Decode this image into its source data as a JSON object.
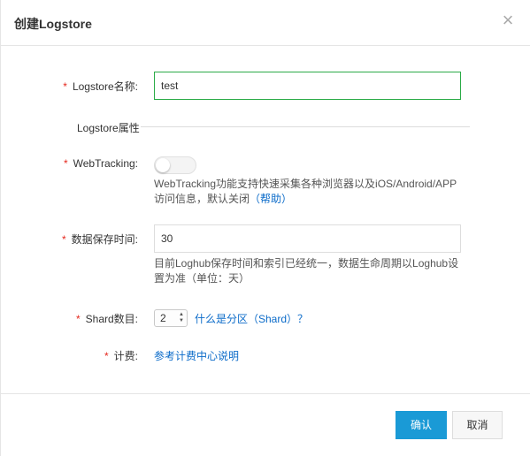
{
  "dialog": {
    "title": "创建Logstore",
    "close_symbol": "×"
  },
  "form": {
    "required_mark": "*",
    "name": {
      "label": "Logstore名称:",
      "value": "test"
    },
    "section_title": "Logstore属性",
    "webtracking": {
      "label": "WebTracking:",
      "enabled": false,
      "help_line1": "WebTracking功能支持快速采集各种浏览器以及iOS/Android/APP",
      "help_line2": "访问信息，默认关闭",
      "help_link": "（帮助）"
    },
    "retention": {
      "label": "数据保存时间:",
      "value": "30",
      "help_line1": "目前Loghub保存时间和索引已经统一，数据生命周期以Loghub设",
      "help_line2": "置为准（单位：天）"
    },
    "shard": {
      "label": "Shard数目:",
      "value": "2",
      "link": "什么是分区（Shard）？"
    },
    "billing": {
      "label": "计费:",
      "link": "参考计费中心说明"
    }
  },
  "footer": {
    "confirm_label": "确认",
    "cancel_label": "取消"
  },
  "colors": {
    "accent": "#1a9ad6",
    "link": "#0b6bc9",
    "required": "#e5281e",
    "focus_border": "#2bab47"
  }
}
